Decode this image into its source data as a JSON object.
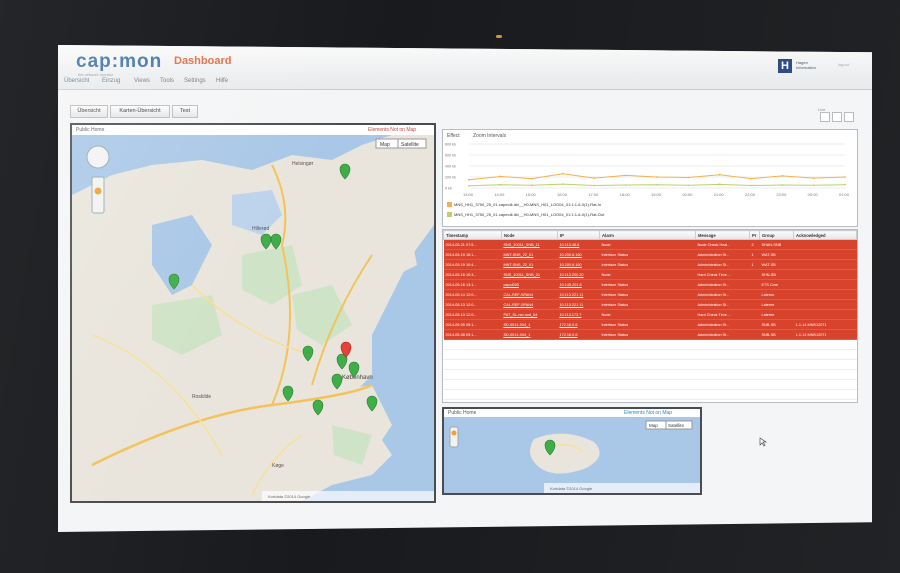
{
  "app": {
    "logo": "cap:mon",
    "logo_sub": "the network monitor",
    "page_title": "Dashboard",
    "menu": [
      "Übersicht",
      "Einzug",
      "Views",
      "Tools",
      "Settings",
      "Hilfe"
    ],
    "brand_text": "Hagen Information",
    "user": "logout"
  },
  "tabs": [
    "Übersicht",
    "Karten-Übersicht",
    "Test"
  ],
  "map_panel": {
    "title": "Public Home",
    "hint": "Elements Not on Map",
    "map_type": [
      "Map",
      "Satellite"
    ],
    "cities": [
      "Helsingør",
      "Hillerød",
      "København",
      "Roskilde",
      "Køge"
    ],
    "attribution": "Kortdata ©2014 Google"
  },
  "chart": {
    "title_a": "Effect",
    "title_b": "Zoom Intervals",
    "y_ticks": [
      "800 kb",
      "600 kb",
      "400 kb",
      "200 kb",
      "0 kb"
    ],
    "x_ticks": [
      "13:00",
      "14:00",
      "15:00",
      "16:00",
      "17:00",
      "18:00",
      "19:00",
      "20:00",
      "21:00",
      "22:00",
      "23:00",
      "00:00",
      "01:00"
    ],
    "legend": [
      "MNS_HH1_3750_25_01.capmdk.dk/__H0-MNS_H01_LOG04_01:1:1-6-0(1)-Rat-In",
      "MNS_HH1_3750_25_01.capmdk.dk/__H0-MNS_H01_LOG04_01:1:1-6-0(1)-Rat-Out"
    ]
  },
  "chart_data": {
    "type": "line",
    "title": "",
    "xlabel": "",
    "ylabel": "",
    "ylim": [
      0,
      800
    ],
    "x": [
      "13:00",
      "14:00",
      "15:00",
      "16:00",
      "17:00",
      "18:00",
      "19:00",
      "20:00",
      "21:00",
      "22:00",
      "23:00",
      "00:00",
      "01:00"
    ],
    "series": [
      {
        "values": [
          150,
          210,
          170,
          260,
          180,
          230,
          200,
          190,
          240,
          170,
          220,
          180,
          200
        ]
      },
      {
        "values": [
          40,
          60,
          50,
          70,
          45,
          55,
          60,
          50,
          65,
          45,
          55,
          50,
          60
        ]
      }
    ]
  },
  "table": {
    "headers": [
      "Timestamp",
      "Node",
      "IP",
      "Alarm",
      "Message",
      "Pr",
      "Group",
      "Acknowledged"
    ],
    "rows": [
      [
        "2014-05-21 07:5...",
        "SNS_10011_SNB_11",
        "10.113.48.8",
        "Node",
        "Node Check Heal...",
        "2",
        "SHAN-SNB",
        ""
      ],
      [
        "2014-05-19 15:1...",
        "MNT-SNS_22_01",
        "10.200.6.160",
        "Interface Status",
        "Administration St...",
        "1",
        "WAT-SB",
        ""
      ],
      [
        "2014-05-19 10:4...",
        "MNT-SNS_22_01",
        "10.200.6.160",
        "Interface Status",
        "Administration St...",
        "1",
        "WAT-SB",
        ""
      ],
      [
        "2014-05-16 10:3...",
        "SNS_10011_SNB_01",
        "10.113.200.20",
        "Node",
        "Hard Check Time...",
        "",
        "SHN-SB",
        ""
      ],
      [
        "2014-05-16 13:1...",
        "capol003",
        "10.145.201.8",
        "Interface Status",
        "Administration St...",
        "",
        "ETS Core",
        ""
      ],
      [
        "2014-05-14 12:0...",
        "CAL-REF-SPAN4",
        "10.113.221.11",
        "Interface Status",
        "Administration St...",
        "",
        "Laterne",
        ""
      ],
      [
        "2014-05-13 12:0...",
        "CAL-REF-SPAN4",
        "10.113.221.11",
        "Interface Status",
        "Administration St...",
        "",
        "Laterne",
        ""
      ],
      [
        "2014-05-13 12:0...",
        "PAT_SL-ner-wnt_04",
        "10.113.173.7",
        "Node",
        "Hard Check Time...",
        "",
        "Laterne",
        ""
      ],
      [
        "2014-05-09 09:1...",
        "SD-0014-004_1",
        "172.16.0.6",
        "Interface Status",
        "Administration St...",
        "",
        "SNB-SB",
        "1-1-14 MNS12071"
      ],
      [
        "2014-05-08 09:1...",
        "SD-0014-004_1",
        "172.16.0.6",
        "Interface Status",
        "Administration St...",
        "",
        "SNB-SB",
        "1-1-14 MNS12071"
      ]
    ]
  },
  "island_panel": {
    "title": "Public Home",
    "hint": "Elements Not on Map",
    "map_type": [
      "Map",
      "Satellite"
    ],
    "attribution": "Kortdata ©2014 Google"
  },
  "colors": {
    "alarm_red": "#d8432d",
    "accent_orange": "#e0693a",
    "logo_blue": "#3b6fa8"
  }
}
